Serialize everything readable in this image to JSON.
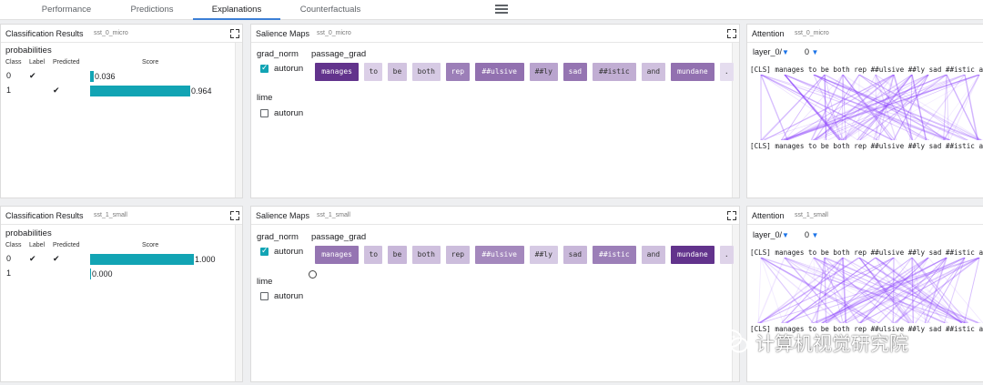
{
  "tabs": [
    {
      "label": "Performance"
    },
    {
      "label": "Predictions"
    },
    {
      "label": "Explanations"
    },
    {
      "label": "Counterfactuals"
    }
  ],
  "rows": [
    {
      "classification": {
        "title": "Classification Results",
        "model": "sst_0_micro",
        "section": "probabilities",
        "headers": {
          "class": "Class",
          "label": "Label",
          "predicted": "Predicted",
          "score": "Score"
        },
        "items": [
          {
            "cls": "0",
            "label": "✔",
            "predicted": "",
            "score": 0.036,
            "score_text": "0.036"
          },
          {
            "cls": "1",
            "label": "",
            "predicted": "✔",
            "score": 0.964,
            "score_text": "0.964"
          }
        ]
      },
      "salience": {
        "title": "Salience Maps",
        "model": "sst_0_micro",
        "method1": "grad_norm",
        "method1_autorun": "autorun",
        "field": "passage_grad",
        "method2": "lime",
        "method2_autorun": "autorun",
        "tokens": [
          {
            "text": "manages",
            "w": 0.95
          },
          {
            "text": "to",
            "w": 0.12
          },
          {
            "text": "be",
            "w": 0.18
          },
          {
            "text": "both",
            "w": 0.15
          },
          {
            "text": "rep",
            "w": 0.55
          },
          {
            "text": "##ulsive",
            "w": 0.62
          },
          {
            "text": "##ly",
            "w": 0.35
          },
          {
            "text": "sad",
            "w": 0.6
          },
          {
            "text": "##istic",
            "w": 0.3
          },
          {
            "text": "and",
            "w": 0.2
          },
          {
            "text": "mundane",
            "w": 0.62
          },
          {
            "text": ".",
            "w": 0.05
          }
        ]
      },
      "attention": {
        "title": "Attention",
        "model": "sst_0_micro",
        "layer": "layer_0/",
        "head": "0",
        "tokens_text": "[CLS] manages to be both rep ##ulsive ##ly sad ##istic and mundane ."
      }
    },
    {
      "classification": {
        "title": "Classification Results",
        "model": "sst_1_small",
        "section": "probabilities",
        "headers": {
          "class": "Class",
          "label": "Label",
          "predicted": "Predicted",
          "score": "Score"
        },
        "items": [
          {
            "cls": "0",
            "label": "✔",
            "predicted": "✔",
            "score": 1.0,
            "score_text": "1.000"
          },
          {
            "cls": "1",
            "label": "",
            "predicted": "",
            "score": 0.0,
            "score_text": "0.000"
          }
        ]
      },
      "salience": {
        "title": "Salience Maps",
        "model": "sst_1_small",
        "method1": "grad_norm",
        "method1_autorun": "autorun",
        "field": "passage_grad",
        "method2": "lime",
        "method2_autorun": "autorun",
        "tokens": [
          {
            "text": "manages",
            "w": 0.6
          },
          {
            "text": "to",
            "w": 0.2
          },
          {
            "text": "be",
            "w": 0.25
          },
          {
            "text": "both",
            "w": 0.2
          },
          {
            "text": "rep",
            "w": 0.22
          },
          {
            "text": "##ulsive",
            "w": 0.5
          },
          {
            "text": "##ly",
            "w": 0.15
          },
          {
            "text": "sad",
            "w": 0.25
          },
          {
            "text": "##istic",
            "w": 0.55
          },
          {
            "text": "and",
            "w": 0.2
          },
          {
            "text": "mundane",
            "w": 0.95
          },
          {
            "text": ".",
            "w": 0.1
          }
        ]
      },
      "attention": {
        "title": "Attention",
        "model": "sst_1_small",
        "layer": "layer_0/",
        "head": "0",
        "tokens_text": "[CLS] manages to be both rep ##ulsive ##ly sad ##istic and mundane ."
      }
    }
  ],
  "colors": {
    "accent": "#12a4b4",
    "salience_dark": "#5b2a86",
    "salience_light": "#ece6f4",
    "attention": "#8a3ffc"
  },
  "watermark": {
    "text": "计算机视觉研究院"
  }
}
